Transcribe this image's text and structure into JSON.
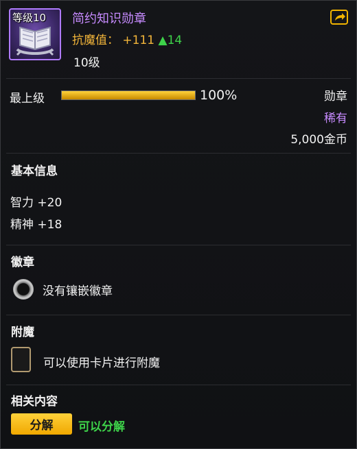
{
  "item": {
    "level_badge": "等级10",
    "name": "简约知识勋章",
    "resistance_label": "抗魔值：",
    "resistance_value": "+111",
    "resistance_up": "▲14",
    "level_text": "10级"
  },
  "progress": {
    "label": "最上级",
    "percent_text": "100%",
    "fill_fraction": 1.0
  },
  "meta": {
    "type": "勋章",
    "rarity": "稀有",
    "price": "5,000金币"
  },
  "sections": {
    "basic_info": "基本信息",
    "emblem": "徽章",
    "enchant": "附魔",
    "related": "相关内容"
  },
  "stats": [
    "智力 +20",
    "精神 +18"
  ],
  "emblem_slot": {
    "text": "没有镶嵌徽章"
  },
  "enchant_slot": {
    "text": "可以使用卡片进行附魔"
  },
  "actions": {
    "disassemble_label": "分解",
    "disassemble_status": "可以分解"
  },
  "colors": {
    "rarity": "#c78bff",
    "resistance": "#f4b63a",
    "positive": "#3ed34a",
    "button": "#f7c21b"
  },
  "icons": {
    "item": "book-medal-icon",
    "share": "share-icon",
    "emblem_slot": "hexagon-socket-icon",
    "card_slot": "card-slot-icon"
  }
}
